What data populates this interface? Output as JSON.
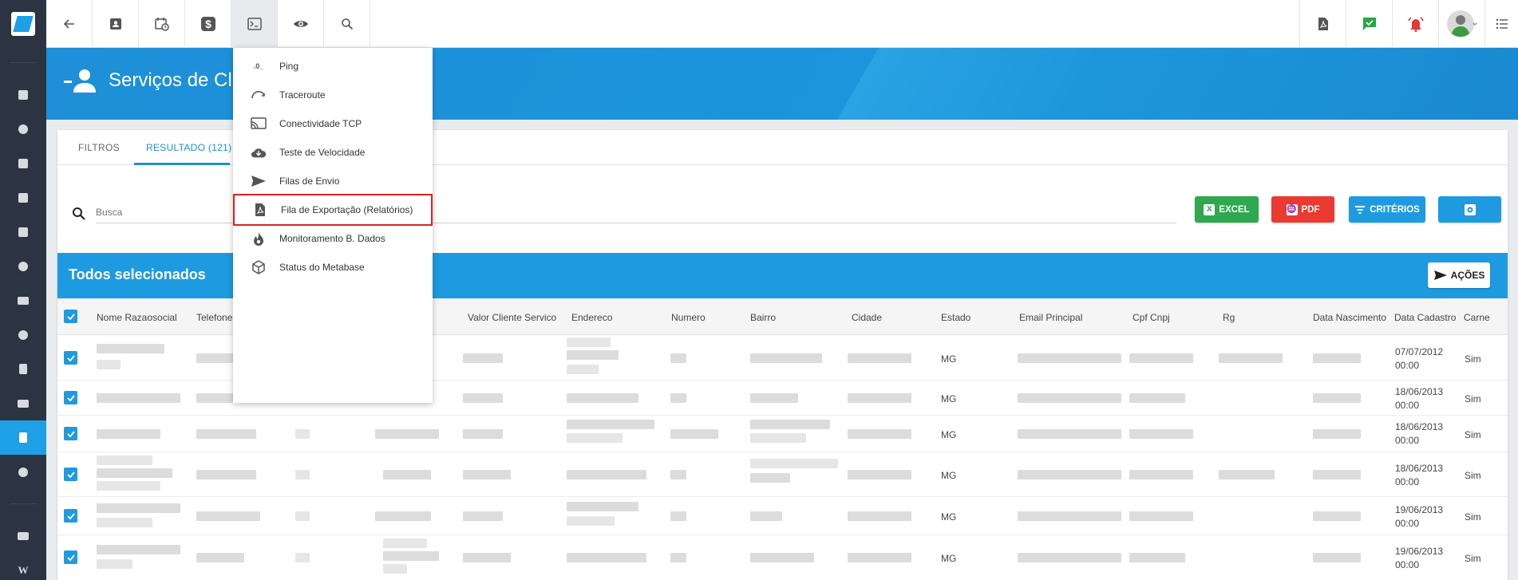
{
  "app": {
    "page_title": "Serviços de Clientes",
    "visible_title": "Serviços de Clier"
  },
  "toolbar": {
    "icons": [
      "back-arrow-icon",
      "contact-card-icon",
      "calendar-clock-icon",
      "dollar-icon",
      "terminal-icon",
      "eye-icon",
      "search-icon"
    ],
    "right_icons": [
      "pdf-file-icon",
      "chat-check-icon",
      "alarm-bell-icon",
      "user-avatar-icon",
      "list-icon"
    ]
  },
  "menu": {
    "items": [
      {
        "label": "Ping",
        "icon": "ping-icon"
      },
      {
        "label": "Traceroute",
        "icon": "traceroute-icon"
      },
      {
        "label": "Conectividade TCP",
        "icon": "cast-icon"
      },
      {
        "label": "Teste de Velocidade",
        "icon": "cloud-download-icon"
      },
      {
        "label": "Filas de Envio",
        "icon": "send-icon"
      },
      {
        "label": "Fila de Exportação (Relatórios)",
        "icon": "pdf-file-icon"
      },
      {
        "label": "Monitoramento B. Dados",
        "icon": "flame-icon"
      },
      {
        "label": "Status do Metabase",
        "icon": "cube-icon"
      }
    ],
    "highlighted_index": 5
  },
  "tabs": {
    "filters": "FILTROS",
    "result": "RESULTADO (121)"
  },
  "search": {
    "placeholder": "Busca"
  },
  "buttons": {
    "excel": "EXCEL",
    "pdf": "PDF",
    "criteria": "CRITÉRIOS",
    "actions": "AÇÕES"
  },
  "selection": {
    "label": "Todos selecionados"
  },
  "table": {
    "columns": {
      "name": "Nome Razaosocial",
      "phone": "Telefone",
      "value": "Valor Cliente Servico",
      "address": "Endereco",
      "number": "Numero",
      "district": "Bairro",
      "city": "Cidade",
      "state": "Estado",
      "email": "Email Principal",
      "cpf": "Cpf Cnpj",
      "rg": "Rg",
      "birth": "Data Nascimento",
      "created": "Data Cadastro",
      "carne": "Carne"
    },
    "rows": [
      {
        "state": "MG",
        "created_date": "07/07/2012",
        "created_time": "00:00",
        "carne": "Sim"
      },
      {
        "state": "MG",
        "created_date": "18/06/2013",
        "created_time": "00:00",
        "carne": "Sim"
      },
      {
        "state": "MG",
        "created_date": "18/06/2013",
        "created_time": "00:00",
        "carne": "Sim"
      },
      {
        "state": "MG",
        "created_date": "18/06/2013",
        "created_time": "00:00",
        "carne": "Sim"
      },
      {
        "state": "MG",
        "created_date": "19/06/2013",
        "created_time": "00:00",
        "carne": "Sim"
      },
      {
        "state": "MG",
        "created_date": "19/06/2013",
        "created_time": "00:00",
        "carne": "Sim"
      }
    ]
  },
  "colors": {
    "primary": "#1e9be0",
    "excel": "#2fa84f",
    "pdf": "#ea3a31",
    "rail": "#2b3440",
    "highlight": "#e0201e"
  }
}
